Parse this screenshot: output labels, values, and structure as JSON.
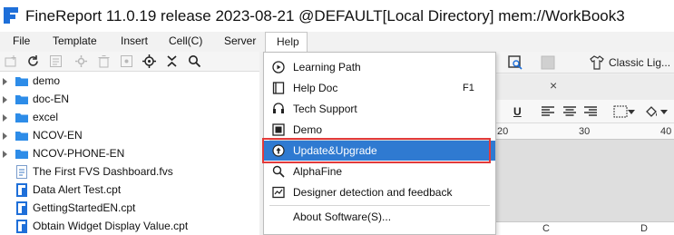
{
  "window": {
    "title": "FineReport 11.0.19 release 2023-08-21 @DEFAULT[Local Directory]      mem://WorkBook3",
    "logo_icon": "finereport-logo-icon"
  },
  "menubar": {
    "items": [
      "File",
      "Template",
      "Insert",
      "Cell(C)",
      "Server",
      "Help"
    ],
    "active": "Help"
  },
  "left_toolbar": {
    "icons": [
      "new-folder-icon",
      "refresh-icon",
      "template-icon",
      "settings-icon",
      "delete-icon",
      "locate-icon",
      "target-icon",
      "collapse-icon",
      "search-icon"
    ]
  },
  "tree": {
    "items": [
      {
        "label": "demo",
        "type": "folder"
      },
      {
        "label": "doc-EN",
        "type": "folder"
      },
      {
        "label": "excel",
        "type": "folder"
      },
      {
        "label": "NCOV-EN",
        "type": "folder"
      },
      {
        "label": "NCOV-PHONE-EN",
        "type": "folder"
      },
      {
        "label": "The First FVS Dashboard.fvs",
        "type": "fvs"
      },
      {
        "label": "Data Alert Test.cpt",
        "type": "cpt"
      },
      {
        "label": "GettingStartedEN.cpt",
        "type": "cpt"
      },
      {
        "label": "Obtain Widget Display Value.cpt",
        "type": "cpt"
      }
    ]
  },
  "help_menu": {
    "items": [
      {
        "label": "Learning Path",
        "icon": "play-circle-icon",
        "shortcut": ""
      },
      {
        "label": "Help Doc",
        "icon": "book-icon",
        "shortcut": "F1"
      },
      {
        "label": "Tech Support",
        "icon": "support-icon",
        "shortcut": ""
      },
      {
        "label": "Demo",
        "icon": "demo-icon",
        "shortcut": ""
      },
      {
        "label": "Update&Upgrade",
        "icon": "update-icon",
        "shortcut": "",
        "highlighted": true
      },
      {
        "label": "AlphaFine",
        "icon": "search-icon",
        "shortcut": ""
      },
      {
        "label": "Designer detection and feedback",
        "icon": "feedback-icon",
        "shortcut": ""
      },
      {
        "label": "About Software(S)...",
        "icon": "",
        "shortcut": ""
      }
    ]
  },
  "right_panel": {
    "theme_label": "Classic Lig...",
    "tab_close": "×",
    "underline": "U",
    "ruler_numbers": [
      "20",
      "30",
      "40"
    ],
    "columns": [
      "C",
      "D"
    ]
  },
  "colors": {
    "highlight": "#2f7ad1",
    "annotation_box": "#e23a3a",
    "logo_blue": "#1e6fd9"
  }
}
